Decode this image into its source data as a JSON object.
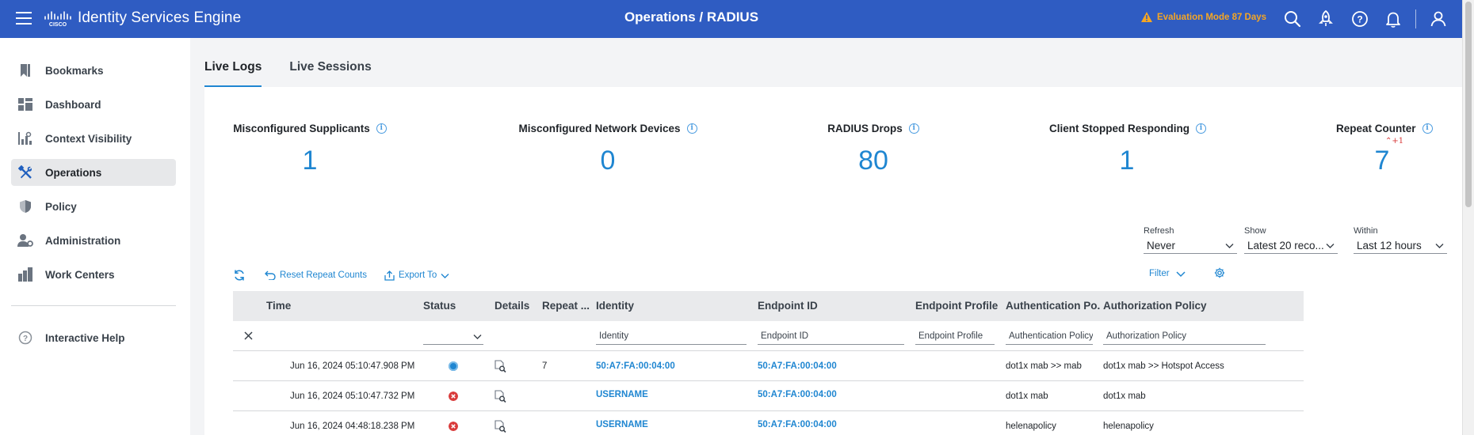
{
  "header": {
    "app_title": "Identity Services Engine",
    "page_title": "Operations / RADIUS",
    "evaluation_text": "Evaluation Mode 87 Days",
    "colors": {
      "bar": "#2f5cc2",
      "warning": "#f5a623"
    }
  },
  "sidebar": {
    "items": [
      {
        "label": "Bookmarks",
        "icon": "bookmark-icon"
      },
      {
        "label": "Dashboard",
        "icon": "dashboard-icon"
      },
      {
        "label": "Context Visibility",
        "icon": "context-visibility-icon"
      },
      {
        "label": "Operations",
        "icon": "wrench-icon",
        "active": true
      },
      {
        "label": "Policy",
        "icon": "shield-icon"
      },
      {
        "label": "Administration",
        "icon": "admin-user-icon"
      },
      {
        "label": "Work Centers",
        "icon": "work-centers-icon"
      }
    ],
    "help_label": "Interactive Help"
  },
  "tabs": [
    {
      "label": "Live Logs",
      "active": true
    },
    {
      "label": "Live Sessions",
      "active": false
    }
  ],
  "counters": [
    {
      "label": "Misconfigured Supplicants",
      "value": "1"
    },
    {
      "label": "Misconfigured Network Devices",
      "value": "0"
    },
    {
      "label": "RADIUS Drops",
      "value": "80"
    },
    {
      "label": "Client Stopped Responding",
      "value": "1"
    },
    {
      "label": "Repeat Counter",
      "value": "7",
      "delta": "+1"
    }
  ],
  "controls": {
    "refresh": {
      "label": "Refresh",
      "value": "Never"
    },
    "show": {
      "label": "Show",
      "value": "Latest 20 reco..."
    },
    "within": {
      "label": "Within",
      "value": "Last 12 hours"
    }
  },
  "toolbar": {
    "reset_label": "Reset Repeat Counts",
    "export_label": "Export To",
    "filter_label": "Filter"
  },
  "table": {
    "columns": [
      "Time",
      "Status",
      "Details",
      "Repeat ...",
      "Identity",
      "Endpoint ID",
      "Endpoint Profile",
      "Authentication Po...",
      "Authorization Policy"
    ],
    "filter_placeholders": {
      "identity": "Identity",
      "endpoint_id": "Endpoint ID",
      "endpoint_profile": "Endpoint Profile",
      "authentication_policy": "Authentication Policy",
      "authorization_policy": "Authorization Policy"
    },
    "rows": [
      {
        "time": "Jun 16, 2024 05:10:47.908 PM",
        "status": "session",
        "status_color": "#1f86d1",
        "repeat": "7",
        "identity": "50:A7:FA:00:04:00",
        "endpoint_id": "50:A7:FA:00:04:00",
        "endpoint_profile": "",
        "authentication_policy": "dot1x mab >> mab",
        "authorization_policy": "dot1x mab >> Hotspot Access"
      },
      {
        "time": "Jun 16, 2024 05:10:47.732 PM",
        "status": "failed",
        "status_color": "#d93b3b",
        "repeat": "",
        "identity": "USERNAME",
        "endpoint_id": "50:A7:FA:00:04:00",
        "endpoint_profile": "",
        "authentication_policy": "dot1x mab",
        "authorization_policy": "dot1x mab"
      },
      {
        "time": "Jun 16, 2024 04:48:18.238 PM",
        "status": "failed",
        "status_color": "#d93b3b",
        "repeat": "",
        "identity": "USERNAME",
        "endpoint_id": "50:A7:FA:00:04:00",
        "endpoint_profile": "",
        "authentication_policy": "helenapolicy",
        "authorization_policy": "helenapolicy"
      }
    ]
  }
}
